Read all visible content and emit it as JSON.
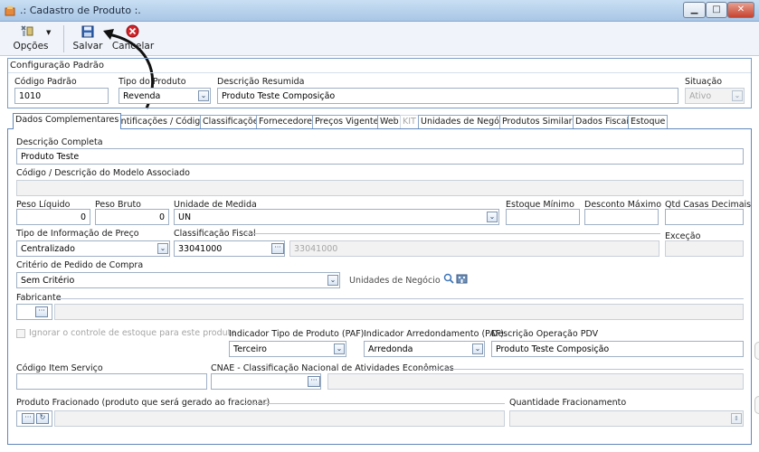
{
  "window": {
    "title": ".: Cadastro de Produto :.",
    "controls": [
      "minimize",
      "maximize",
      "close"
    ]
  },
  "toolbar": {
    "options_label": "Opções",
    "save_label": "Salvar",
    "cancel_label": "Cancelar"
  },
  "config": {
    "section_title": "Configuração Padrão",
    "codigo_padrao_label": "Código Padrão",
    "codigo_padrao_value": "1010",
    "tipo_produto_label": "Tipo do Produto",
    "tipo_produto_value": "Revenda",
    "descricao_resumida_label": "Descrição Resumida",
    "descricao_resumida_value": "Produto Teste Composição",
    "situacao_label": "Situação",
    "situacao_value": "Ativo"
  },
  "tabs": [
    {
      "label": "Dados Complementares"
    },
    {
      "label": "Identificações / Códigos"
    },
    {
      "label": "Classificações"
    },
    {
      "label": "Fornecedores"
    },
    {
      "label": "Preços Vigentes"
    },
    {
      "label": "Web"
    },
    {
      "label": "KIT"
    },
    {
      "label": "Unidades de Negócio"
    },
    {
      "label": "Produtos Similares"
    },
    {
      "label": "Dados Fiscais"
    },
    {
      "label": "Estoque"
    }
  ],
  "form": {
    "descricao_completa_label": "Descrição Completa",
    "descricao_completa_value": "Produto Teste",
    "modelo_label": "Código / Descrição do Modelo Associado",
    "peso_liquido_label": "Peso Líquido",
    "peso_liquido_value": "0",
    "peso_bruto_label": "Peso Bruto",
    "peso_bruto_value": "0",
    "unidade_medida_label": "Unidade de Medida",
    "unidade_medida_value": "UN",
    "estoque_minimo_label": "Estoque Mínimo",
    "desconto_maximo_label": "Desconto Máximo",
    "qtd_casas_label": "Qtd Casas Decimais",
    "tipo_info_preco_label": "Tipo de Informação de Preço",
    "tipo_info_preco_value": "Centralizado",
    "classificacao_fiscal_label": "Classificação Fiscal",
    "classificacao_fiscal_code": "33041000",
    "classificacao_fiscal_desc": "33041000",
    "excecao_label": "Exceção",
    "criterio_label": "Critério de Pedido de Compra",
    "criterio_value": "Sem Critério",
    "unidades_negocio_label": "Unidades de Negócio",
    "fabricante_label": "Fabricante",
    "ignorar_estoque_label": "Ignorar o controle de estoque para este produto",
    "indicador_tipo_label": "Indicador Tipo de Produto (PAF)",
    "indicador_tipo_value": "Terceiro",
    "indicador_arred_label": "Indicador Arredondamento (PAF)",
    "indicador_arred_value": "Arredonda",
    "descricao_pdv_label": "Descrição Operação PDV",
    "descricao_pdv_value": "Produto Teste Composição",
    "codigo_item_servico_label": "Código Item Serviço",
    "cnae_label": "CNAE - Classificação Nacional de Atividades Econômicas",
    "produto_fracionado_label": "Produto Fracionado (produto que será gerado ao fracionar)",
    "quantidade_fracionamento_label": "Quantidade Fracionamento"
  },
  "colors": {
    "accent_border": "#7a9cc6",
    "title_bar": "#b9d2ee",
    "close_button": "#c7432e"
  }
}
